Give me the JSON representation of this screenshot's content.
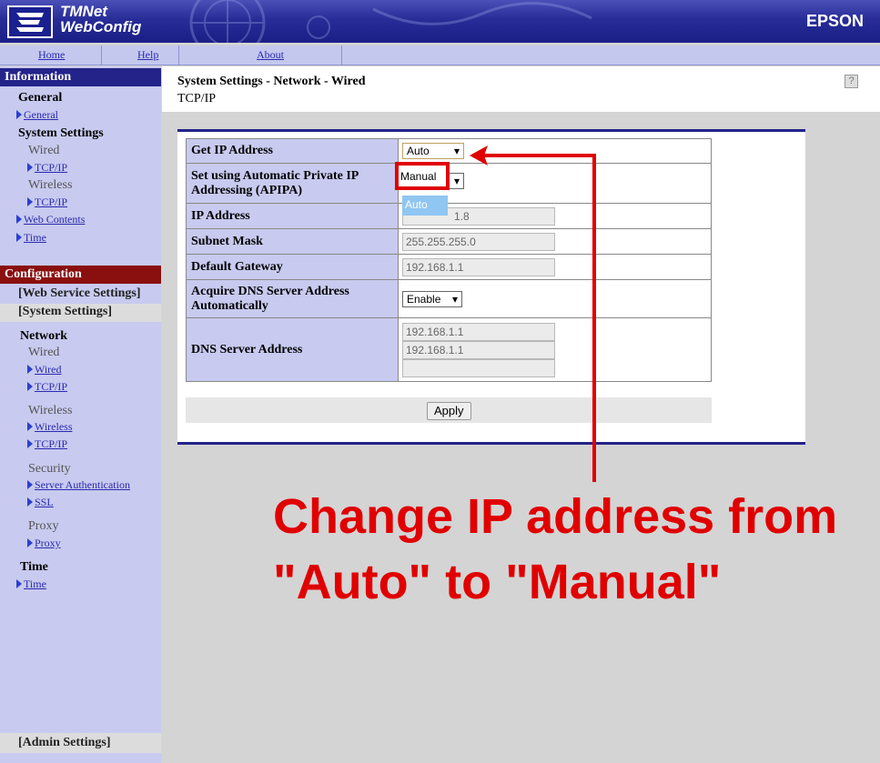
{
  "header": {
    "app_title_line1": "TMNet",
    "app_title_line2": "WebConfig",
    "brand": "EPSON"
  },
  "nav": {
    "home": "Home",
    "help": "Help",
    "about": "About"
  },
  "sidebar": {
    "information_header": "Information",
    "general": "General",
    "general_link": "General",
    "system_settings": "System Settings",
    "wired": "Wired",
    "wired_tcpip": "TCP/IP",
    "wireless": "Wireless",
    "wireless_tcpip": "TCP/IP",
    "web_contents": "Web Contents",
    "time_link": "Time",
    "configuration_header": "Configuration",
    "web_service_settings": "[Web Service Settings]",
    "system_settings_bracket": "[System Settings]",
    "network": "Network",
    "cfg_wired": "Wired",
    "cfg_wired_link": "Wired",
    "cfg_wired_tcpip": "TCP/IP",
    "cfg_wireless": "Wireless",
    "cfg_wireless_link": "Wireless",
    "cfg_wireless_tcpip": "TCP/IP",
    "security": "Security",
    "server_auth": "Server Authentication",
    "ssl": "SSL",
    "proxy": "Proxy",
    "proxy_link": "Proxy",
    "time": "Time",
    "cfg_time_link": "Time",
    "admin_settings": "[Admin Settings]"
  },
  "main": {
    "breadcrumb": "System Settings - Network - Wired",
    "subtitle": "TCP/IP",
    "help_icon": "?",
    "rows": {
      "get_ip_label": "Get IP Address",
      "get_ip_value": "Auto",
      "apipa_label": "Set using Automatic Private IP Addressing (APIPA)",
      "ip_label": "IP Address",
      "ip_value": "1.8",
      "subnet_label": "Subnet Mask",
      "subnet_value": "255.255.255.0",
      "gateway_label": "Default Gateway",
      "gateway_value": "192.168.1.1",
      "dns_auto_label": "Acquire DNS Server Address Automatically",
      "dns_auto_value": "Enable",
      "dns_label": "DNS Server Address",
      "dns1": "192.168.1.1",
      "dns2": "192.168.1.1",
      "dns3": ""
    },
    "apply": "Apply",
    "dropdown": {
      "option_manual": "Manual",
      "option_auto": "Auto"
    }
  },
  "annotation": {
    "line1": "Change IP address from",
    "line2": "\"Auto\" to \"Manual\"",
    "color": "#e00000"
  }
}
